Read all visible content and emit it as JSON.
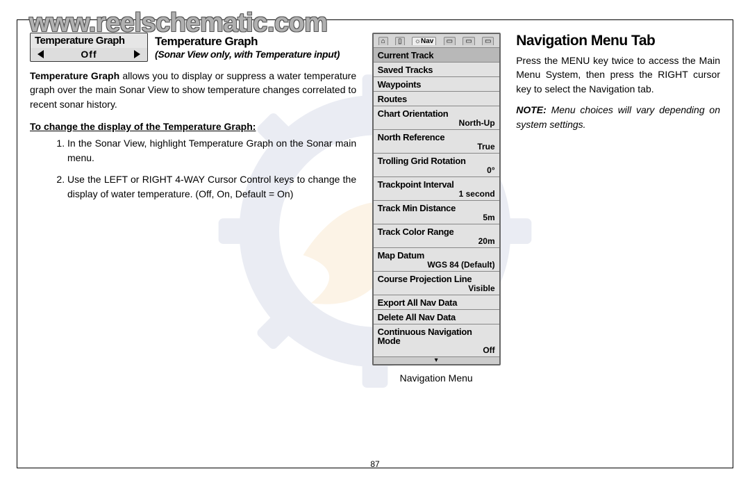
{
  "watermark_url": "www.reelschematic.com",
  "page_number": "87",
  "left": {
    "widget_title": "Temperature Graph",
    "widget_value": "Off",
    "section_title": "Temperature Graph",
    "section_sub": "(Sonar View only, with Temperature input)",
    "intro_lead": "Temperature Graph",
    "intro_rest": " allows you to display or suppress a water temperature graph over the main Sonar View to show temperature changes correlated to recent sonar history.",
    "subhead": "To change the display of the Temperature Graph:",
    "steps": [
      "In the Sonar View, highlight Temperature Graph on the Sonar main menu.",
      "Use the LEFT or RIGHT 4-WAY Cursor Control keys to change the display of water temperature. (Off, On, Default = On)"
    ]
  },
  "nav": {
    "tabs_selected": "☼Nav",
    "items": [
      {
        "label": "Current Track",
        "value": ""
      },
      {
        "label": "Saved Tracks",
        "value": ""
      },
      {
        "label": "Waypoints",
        "value": ""
      },
      {
        "label": "Routes",
        "value": ""
      },
      {
        "label": "Chart Orientation",
        "value": "North-Up"
      },
      {
        "label": "North Reference",
        "value": "True"
      },
      {
        "label": "Trolling Grid Rotation",
        "value": "0°"
      },
      {
        "label": "Trackpoint Interval",
        "value": "1 second"
      },
      {
        "label": "Track Min Distance",
        "value": "5m"
      },
      {
        "label": "Track Color Range",
        "value": "20m"
      },
      {
        "label": "Map Datum",
        "value": "WGS 84 (Default)"
      },
      {
        "label": "Course Projection Line",
        "value": "Visible"
      },
      {
        "label": "Export All Nav Data",
        "value": ""
      },
      {
        "label": "Delete All Nav Data",
        "value": ""
      },
      {
        "label": "Continuous Navigation Mode",
        "value": "Off"
      }
    ],
    "caption": "Navigation Menu"
  },
  "right": {
    "title": "Navigation Menu Tab",
    "body": "Press the MENU key twice to access the Main Menu System, then press the RIGHT cursor key to select the Navigation tab.",
    "note_lead": "NOTE:",
    "note_rest": " Menu choices will vary depending on system settings."
  }
}
